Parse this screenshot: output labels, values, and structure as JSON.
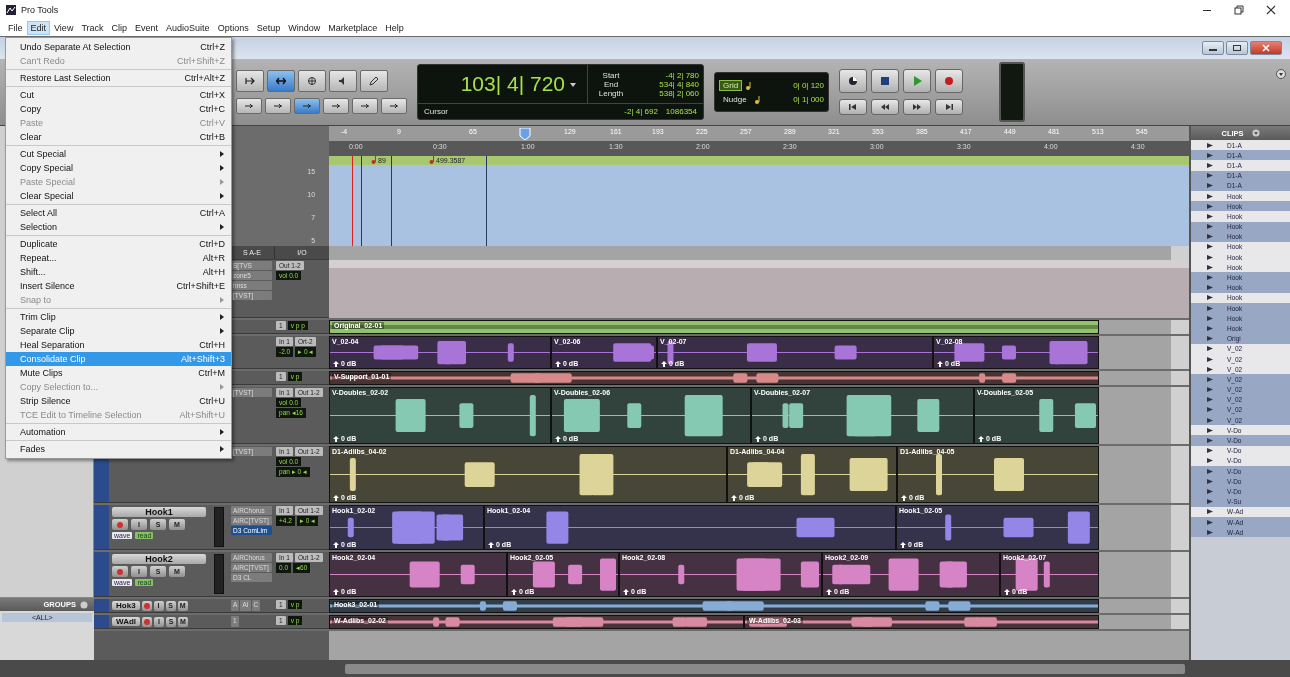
{
  "app": {
    "title": "Pro Tools"
  },
  "menubar": [
    {
      "label": "File",
      "selected": false
    },
    {
      "label": "Edit",
      "selected": true
    },
    {
      "label": "View",
      "selected": false
    },
    {
      "label": "Track",
      "selected": false
    },
    {
      "label": "Clip",
      "selected": false
    },
    {
      "label": "Event",
      "selected": false
    },
    {
      "label": "AudioSuite",
      "selected": false
    },
    {
      "label": "Options",
      "selected": false
    },
    {
      "label": "Setup",
      "selected": false
    },
    {
      "label": "Window",
      "selected": false
    },
    {
      "label": "Marketplace",
      "selected": false
    },
    {
      "label": "Help",
      "selected": false
    }
  ],
  "edit_menu": {
    "sections": [
      [
        {
          "label": "Undo Separate At Selection",
          "shortcut": "Ctrl+Z",
          "disabled": false,
          "submenu": false,
          "selected": false
        },
        {
          "label": "Can't Redo",
          "shortcut": "Ctrl+Shift+Z",
          "disabled": true,
          "submenu": false,
          "selected": false
        }
      ],
      [
        {
          "label": "Restore Last Selection",
          "shortcut": "Ctrl+Alt+Z",
          "disabled": false,
          "submenu": false,
          "selected": false
        }
      ],
      [
        {
          "label": "Cut",
          "shortcut": "Ctrl+X",
          "disabled": false,
          "submenu": false,
          "selected": false
        },
        {
          "label": "Copy",
          "shortcut": "Ctrl+C",
          "disabled": false,
          "submenu": false,
          "selected": false
        },
        {
          "label": "Paste",
          "shortcut": "Ctrl+V",
          "disabled": true,
          "submenu": false,
          "selected": false
        },
        {
          "label": "Clear",
          "shortcut": "Ctrl+B",
          "disabled": false,
          "submenu": false,
          "selected": false
        }
      ],
      [
        {
          "label": "Cut Special",
          "disabled": false,
          "submenu": true,
          "selected": false
        },
        {
          "label": "Copy Special",
          "disabled": false,
          "submenu": true,
          "selected": false
        },
        {
          "label": "Paste Special",
          "disabled": true,
          "submenu": true,
          "selected": false
        },
        {
          "label": "Clear Special",
          "disabled": false,
          "submenu": true,
          "selected": false
        }
      ],
      [
        {
          "label": "Select All",
          "shortcut": "Ctrl+A",
          "disabled": false,
          "submenu": false,
          "selected": false
        },
        {
          "label": "Selection",
          "disabled": false,
          "submenu": true,
          "selected": false
        }
      ],
      [
        {
          "label": "Duplicate",
          "shortcut": "Ctrl+D",
          "disabled": false,
          "submenu": false,
          "selected": false
        },
        {
          "label": "Repeat...",
          "shortcut": "Alt+R",
          "disabled": false,
          "submenu": false,
          "selected": false
        },
        {
          "label": "Shift...",
          "shortcut": "Alt+H",
          "disabled": false,
          "submenu": false,
          "selected": false
        },
        {
          "label": "Insert Silence",
          "shortcut": "Ctrl+Shift+E",
          "disabled": false,
          "submenu": false,
          "selected": false
        },
        {
          "label": "Snap to",
          "disabled": true,
          "submenu": true,
          "selected": false
        }
      ],
      [
        {
          "label": "Trim Clip",
          "disabled": false,
          "submenu": true,
          "selected": false
        },
        {
          "label": "Separate Clip",
          "disabled": false,
          "submenu": true,
          "selected": false
        },
        {
          "label": "Heal Separation",
          "shortcut": "Ctrl+H",
          "disabled": false,
          "submenu": false,
          "selected": false
        },
        {
          "label": "Consolidate Clip",
          "shortcut": "Alt+Shift+3",
          "disabled": false,
          "submenu": false,
          "selected": true
        },
        {
          "label": "Mute Clips",
          "shortcut": "Ctrl+M",
          "disabled": false,
          "submenu": false,
          "selected": false
        },
        {
          "label": "Copy Selection to...",
          "disabled": true,
          "submenu": true,
          "selected": false
        },
        {
          "label": "Strip Silence",
          "shortcut": "Ctrl+U",
          "disabled": false,
          "submenu": false,
          "selected": false
        },
        {
          "label": "TCE Edit to Timeline Selection",
          "shortcut": "Alt+Shift+U",
          "disabled": true,
          "submenu": false,
          "selected": false
        }
      ],
      [
        {
          "label": "Automation",
          "disabled": false,
          "submenu": true,
          "selected": false
        }
      ],
      [
        {
          "label": "Fades",
          "disabled": false,
          "submenu": true,
          "selected": false
        }
      ]
    ]
  },
  "toolbar": {
    "edit_tools": [
      {
        "selected": false
      },
      {
        "selected": true
      },
      {
        "selected": false
      },
      {
        "selected": false
      },
      {
        "selected": false
      }
    ],
    "edit_modes": [
      {
        "selected": false
      },
      {
        "selected": false
      },
      {
        "selected": true
      },
      {
        "selected": false
      },
      {
        "selected": false
      },
      {
        "selected": false
      }
    ],
    "counter": {
      "main": "103| 4| 720",
      "fields": [
        {
          "label": "Start",
          "value": "-4| 2| 780"
        },
        {
          "label": "End",
          "value": "534| 4| 840"
        },
        {
          "label": "Length",
          "value": "538| 2| 060"
        }
      ],
      "cursor_label": "Cursor",
      "cursor": "-2| 4| 692",
      "samples": "1086354"
    },
    "grid_nudge": [
      {
        "label": "Grid",
        "value": "0| 0| 120",
        "selected": true
      },
      {
        "label": "Nudge",
        "value": "0| 1| 000",
        "selected": false
      }
    ]
  },
  "rulers": {
    "bars": [
      "-4",
      "9",
      "65",
      "129",
      "161",
      "193",
      "225",
      "257",
      "289",
      "321",
      "353",
      "385",
      "417",
      "449",
      "481",
      "513",
      "545"
    ],
    "times": [
      "0:00",
      "0:30",
      "1:00",
      "1:30",
      "2:00",
      "2:30",
      "3:00",
      "3:30",
      "4:00",
      "4:30"
    ],
    "tempo_markers": [
      "89",
      "499.3587"
    ],
    "tempo_scale": [
      "15",
      "10",
      "7",
      "5"
    ]
  },
  "track_headers": {
    "inserts_heading": "S A-E",
    "io_heading": "I/O"
  },
  "tracks": [
    {
      "kind": "aux",
      "inserts": [
        {
          "label": "S[TVS",
          "selected": false
        },
        {
          "label": "zone5",
          "selected": false
        },
        {
          "label": "hnss",
          "selected": false
        },
        {
          "label": "[TVST]",
          "selected": false
        }
      ],
      "io": [
        {
          "text": "Out 1-2",
          "kind": "button"
        },
        {
          "text": "vol 0.0",
          "kind": "display"
        }
      ],
      "color": "#b8aeb1"
    },
    {
      "kind": "overview",
      "io": [
        {
          "text": "1",
          "kind": "button"
        },
        {
          "text": "v p p",
          "kind": "display"
        }
      ],
      "color": "#93c16c",
      "clips": [
        {
          "name": "Original_02-01"
        }
      ]
    },
    {
      "kind": "medium",
      "io": [
        {
          "text": "In 1",
          "kind": "button"
        },
        {
          "text": "Ort-2",
          "kind": "button"
        },
        {
          "text": "-2.0",
          "kind": "display"
        },
        {
          "text": "▸ 0 ◂",
          "kind": "display"
        }
      ],
      "color": "#a874d8",
      "clips": [
        {
          "name": "V_02-04",
          "gain": "0 dB"
        },
        {
          "name": "V_02-06",
          "gain": "0 dB"
        },
        {
          "name": "V_02-07",
          "gain": "0 dB"
        },
        {
          "name": "V_02-08",
          "gain": "0 dB"
        }
      ]
    },
    {
      "kind": "thin",
      "io": [
        {
          "text": "1",
          "kind": "button"
        },
        {
          "text": "v p",
          "kind": "display"
        }
      ],
      "color": "#d88a8a",
      "clips": [
        {
          "name": "V-Support_01-01"
        }
      ]
    },
    {
      "kind": "tall",
      "inserts": [
        {
          "label": "[TVST]",
          "selected": false
        }
      ],
      "io": [
        {
          "text": "In 1",
          "kind": "button"
        },
        {
          "text": "Out 1-2",
          "kind": "button"
        },
        {
          "text": "vol 0.0",
          "kind": "display"
        },
        {
          "text": "pan ◂16",
          "kind": "display"
        }
      ],
      "color": "#86c9b2",
      "clips": [
        {
          "name": "V-Doubles_02-02",
          "gain": "0 dB"
        },
        {
          "name": "V-Doubles_02-06",
          "gain": "0 dB"
        },
        {
          "name": "V-Doubles_02-07",
          "gain": "0 dB"
        },
        {
          "name": "V-Doubles_02-05",
          "gain": "0 dB"
        }
      ]
    },
    {
      "kind": "tall",
      "inserts": [
        {
          "label": "[TVST]",
          "selected": false
        }
      ],
      "io": [
        {
          "text": "In 1",
          "kind": "button"
        },
        {
          "text": "Out 1-2",
          "kind": "button"
        },
        {
          "text": "vol 0.0",
          "kind": "display"
        },
        {
          "text": "pan ▸ 0 ◂",
          "kind": "display"
        }
      ],
      "color": "#dcd498",
      "clips": [
        {
          "name": "D1-Adlibs_04-02",
          "gain": "0 dB"
        },
        {
          "name": "D1-Adlibs_04-04",
          "gain": "0 dB"
        },
        {
          "name": "D1-Adlibs_04-05",
          "gain": "0 dB"
        }
      ]
    },
    {
      "kind": "hook",
      "name": "Hook1",
      "buttons": [
        "I",
        "S",
        "M"
      ],
      "view": "wave",
      "automation": "read",
      "inserts": [
        {
          "label": "AIRChorus",
          "selected": false
        },
        {
          "label": "AIRC[TVST]",
          "selected": false
        },
        {
          "label": "D3 ComLim",
          "selected": true
        }
      ],
      "io": [
        {
          "text": "In 1",
          "kind": "button"
        },
        {
          "text": "Out 1-2",
          "kind": "button"
        },
        {
          "text": "+4.2",
          "kind": "display"
        },
        {
          "text": "▸ 0 ◂",
          "kind": "display"
        }
      ],
      "color": "#9486e6",
      "clips": [
        {
          "name": "Hook1_02-02",
          "gain": "0 dB"
        },
        {
          "name": "Hook1_02-04",
          "gain": "0 dB"
        },
        {
          "name": "Hook1_02-05",
          "gain": "0 dB"
        }
      ]
    },
    {
      "kind": "hook",
      "name": "Hook2",
      "buttons": [
        "I",
        "S",
        "M"
      ],
      "view": "wave",
      "automation": "read",
      "inserts": [
        {
          "label": "AIRChorus",
          "selected": false
        },
        {
          "label": "AIRC[TVST]",
          "selected": false
        },
        {
          "label": "D3 CL",
          "selected": false
        }
      ],
      "io": [
        {
          "text": "In 1",
          "kind": "button"
        },
        {
          "text": "Out 1-2",
          "kind": "button"
        },
        {
          "text": "0.0",
          "kind": "display"
        },
        {
          "text": "◂60",
          "kind": "display"
        }
      ],
      "color": "#d684c6",
      "clips": [
        {
          "name": "Hook2_02-04",
          "gain": "0 dB"
        },
        {
          "name": "Hook2_02-05",
          "gain": "0 dB"
        },
        {
          "name": "Hook2_02-08",
          "gain": "0 dB"
        },
        {
          "name": "Hook2_02-09",
          "gain": "0 dB"
        },
        {
          "name": "Hook2_02-07",
          "gain": "0 dB"
        }
      ]
    },
    {
      "kind": "thin",
      "name": "Hok3",
      "buttons": [
        "I",
        "S",
        "M"
      ],
      "inserts": [
        {
          "label": "A",
          "selected": false
        },
        {
          "label": "AI",
          "selected": false
        },
        {
          "label": "C",
          "selected": false
        }
      ],
      "io": [
        {
          "text": "1",
          "kind": "button"
        },
        {
          "text": "v p",
          "kind": "display"
        }
      ],
      "color": "#86acd6",
      "clips": [
        {
          "name": "Hook3_02-01"
        }
      ]
    },
    {
      "kind": "thin",
      "name": "WAdl",
      "buttons": [
        "I",
        "S",
        "M"
      ],
      "inserts": [
        {
          "label": "1",
          "selected": false
        }
      ],
      "io": [
        {
          "text": "1",
          "kind": "button"
        },
        {
          "text": "v p",
          "kind": "display"
        }
      ],
      "color": "#d88aa0",
      "clips": [
        {
          "name": "W-Adlibs_02-02"
        },
        {
          "name": "W-Adlibs_02-03"
        }
      ]
    }
  ],
  "clips_list": {
    "title": "CLIPS",
    "items": [
      {
        "name": "D1-A",
        "selected": false
      },
      {
        "name": "D1-A",
        "selected": true
      },
      {
        "name": "D1-A",
        "selected": false
      },
      {
        "name": "D1-A",
        "selected": true
      },
      {
        "name": "D1-A",
        "selected": true
      },
      {
        "name": "Hook",
        "selected": false
      },
      {
        "name": "Hook",
        "selected": true
      },
      {
        "name": "Hook",
        "selected": false
      },
      {
        "name": "Hook",
        "selected": true
      },
      {
        "name": "Hook",
        "selected": true
      },
      {
        "name": "Hook",
        "selected": false
      },
      {
        "name": "Hook",
        "selected": false
      },
      {
        "name": "Hook",
        "selected": false
      },
      {
        "name": "Hook",
        "selected": true
      },
      {
        "name": "Hook",
        "selected": true
      },
      {
        "name": "Hook",
        "selected": false
      },
      {
        "name": "Hook",
        "selected": true
      },
      {
        "name": "Hook",
        "selected": true
      },
      {
        "name": "Hook",
        "selected": true
      },
      {
        "name": "Origi",
        "selected": true
      },
      {
        "name": "V_02",
        "selected": false
      },
      {
        "name": "V_02",
        "selected": false
      },
      {
        "name": "V_02",
        "selected": false
      },
      {
        "name": "V_02",
        "selected": true
      },
      {
        "name": "V_02",
        "selected": true
      },
      {
        "name": "V_02",
        "selected": true
      },
      {
        "name": "V_02",
        "selected": true
      },
      {
        "name": "V_02",
        "selected": true
      },
      {
        "name": "V-Do",
        "selected": false
      },
      {
        "name": "V-Do",
        "selected": true
      },
      {
        "name": "V-Do",
        "selected": false
      },
      {
        "name": "V-Do",
        "selected": false
      },
      {
        "name": "V-Do",
        "selected": true
      },
      {
        "name": "V-Do",
        "selected": true
      },
      {
        "name": "V-Do",
        "selected": true
      },
      {
        "name": "V-Su",
        "selected": true
      },
      {
        "name": "W-Ad",
        "selected": false
      },
      {
        "name": "W-Ad",
        "selected": true
      },
      {
        "name": "W-Ad",
        "selected": true
      }
    ]
  },
  "groups": {
    "title": "GROUPS",
    "items": [
      "<ALL>"
    ]
  }
}
